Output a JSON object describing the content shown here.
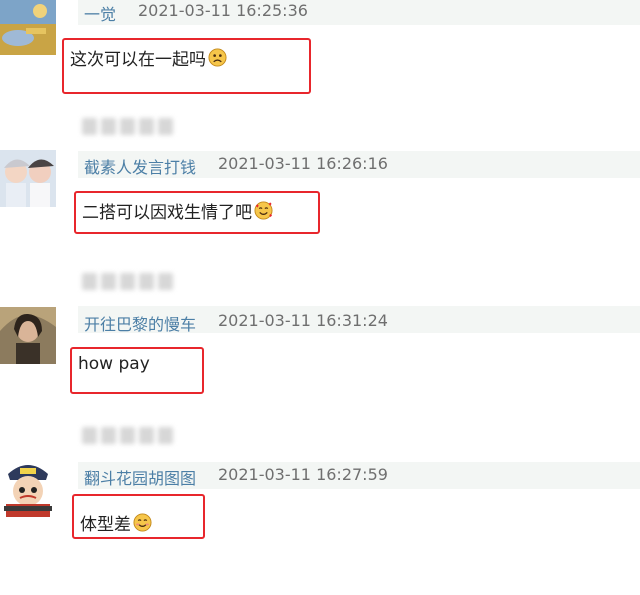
{
  "comments": [
    {
      "username": "一觉",
      "timestamp": "2021-03-11 16:25:36",
      "text": "这次可以在一起吗",
      "emoji": "frown-face-emoji"
    },
    {
      "username": "截素人发言打钱",
      "timestamp": "2021-03-11 16:26:16",
      "text": "二搭可以因戏生情了吧",
      "emoji": "smiling-hearts-face-emoji"
    },
    {
      "username": "开往巴黎的慢车",
      "timestamp": "2021-03-11 16:31:24",
      "text": "how pay",
      "emoji": ""
    },
    {
      "username": "翻斗花园胡图图",
      "timestamp": "2021-03-11 16:27:59",
      "text": "体型差",
      "emoji": "smiling-face-emoji"
    }
  ],
  "colors": {
    "username": "#4c7fa6",
    "timestamp": "#6f6f6f",
    "highlight_border": "#e8262c",
    "header_bg": "#f3f6f4"
  }
}
